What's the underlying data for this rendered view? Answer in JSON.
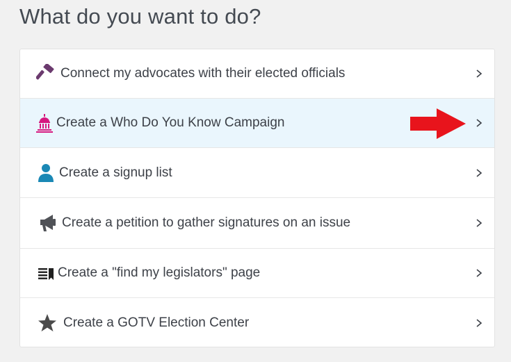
{
  "page": {
    "title": "What do you want to do?"
  },
  "options": [
    {
      "label": "Connect my advocates with their elected officials",
      "icon": "gavel-icon",
      "icon_color": "#6b3a6e"
    },
    {
      "label": "Create a Who Do You Know Campaign",
      "icon": "capitol-building-icon",
      "icon_color": "#d6187f"
    },
    {
      "label": "Create a signup list",
      "icon": "person-icon",
      "icon_color": "#1a88b5"
    },
    {
      "label": "Create a petition to gather signatures on an issue",
      "icon": "megaphone-icon",
      "icon_color": "#505257"
    },
    {
      "label": "Create a \"find my legislators\" page",
      "icon": "list-bookmark-icon",
      "icon_color": "#1f1f1f"
    },
    {
      "label": "Create a GOTV Election Center",
      "icon": "star-icon",
      "icon_color": "#4b4b4b"
    }
  ],
  "annotation": {
    "arrow_color": "#e8141c"
  }
}
